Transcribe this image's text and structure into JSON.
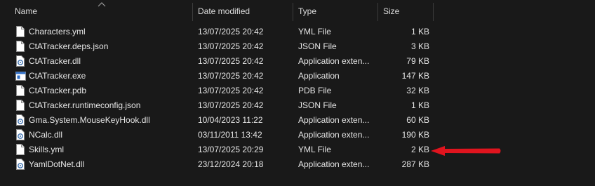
{
  "columns": {
    "name": "Name",
    "date": "Date modified",
    "type": "Type",
    "size": "Size"
  },
  "files": [
    {
      "name": "Characters.yml",
      "date": "13/07/2025 20:42",
      "type": "YML File",
      "size": "1 KB",
      "icon": "document-icon"
    },
    {
      "name": "CtATracker.deps.json",
      "date": "13/07/2025 20:42",
      "type": "JSON File",
      "size": "3 KB",
      "icon": "document-icon"
    },
    {
      "name": "CtATracker.dll",
      "date": "13/07/2025 20:42",
      "type": "Application exten...",
      "size": "79 KB",
      "icon": "dll-gear-icon"
    },
    {
      "name": "CtATracker.exe",
      "date": "13/07/2025 20:42",
      "type": "Application",
      "size": "147 KB",
      "icon": "application-window-icon"
    },
    {
      "name": "CtATracker.pdb",
      "date": "13/07/2025 20:42",
      "type": "PDB File",
      "size": "32 KB",
      "icon": "document-icon"
    },
    {
      "name": "CtATracker.runtimeconfig.json",
      "date": "13/07/2025 20:42",
      "type": "JSON File",
      "size": "1 KB",
      "icon": "document-icon"
    },
    {
      "name": "Gma.System.MouseKeyHook.dll",
      "date": "10/04/2023 11:22",
      "type": "Application exten...",
      "size": "60 KB",
      "icon": "dll-gear-icon"
    },
    {
      "name": "NCalc.dll",
      "date": "03/11/2011 13:42",
      "type": "Application exten...",
      "size": "190 KB",
      "icon": "dll-gear-icon"
    },
    {
      "name": "Skills.yml",
      "date": "13/07/2025 20:29",
      "type": "YML File",
      "size": "2 KB",
      "icon": "document-icon"
    },
    {
      "name": "YamlDotNet.dll",
      "date": "23/12/2024 20:18",
      "type": "Application exten...",
      "size": "287 KB",
      "icon": "dll-gear-icon"
    }
  ],
  "annotation": {
    "icon": "red-arrow-icon",
    "color": "#e0141e"
  },
  "colors": {
    "background": "#191919",
    "text": "#e6e6e6",
    "divider": "#3c3c3c"
  }
}
